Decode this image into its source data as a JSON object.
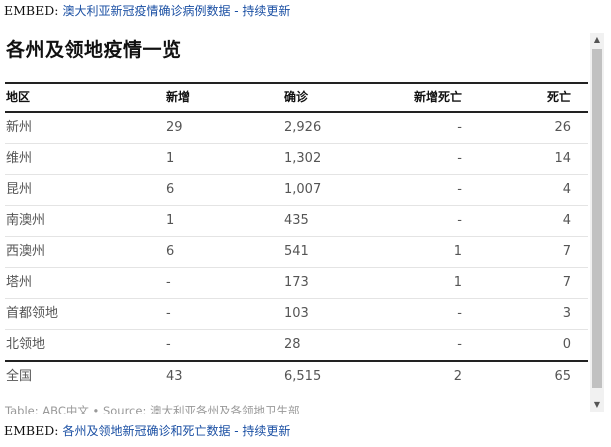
{
  "embed_top": {
    "prefix": "EMBED: ",
    "link": "澳大利亚新冠疫情确诊病例数据 - 持续更新"
  },
  "embed_bottom": {
    "prefix": "EMBED: ",
    "link": "各州及领地新冠确诊和死亡数据 - 持续更新"
  },
  "title": "各州及领地疫情一览",
  "columns": [
    "地区",
    "新增",
    "确诊",
    "新增死亡",
    "死亡"
  ],
  "rows": [
    [
      "新州",
      "29",
      "2,926",
      "-",
      "26"
    ],
    [
      "维州",
      "1",
      "1,302",
      "-",
      "14"
    ],
    [
      "昆州",
      "6",
      "1,007",
      "-",
      "4"
    ],
    [
      "南澳州",
      "1",
      "435",
      "-",
      "4"
    ],
    [
      "西澳州",
      "6",
      "541",
      "1",
      "7"
    ],
    [
      "塔州",
      "-",
      "173",
      "1",
      "7"
    ],
    [
      "首都领地",
      "-",
      "103",
      "-",
      "3"
    ],
    [
      "北领地",
      "-",
      "28",
      "-",
      "0"
    ]
  ],
  "total": [
    "全国",
    "43",
    "6,515",
    "2",
    "65"
  ],
  "source": "Table: ABC中文 • Source: 澳大利亚各州及各领地卫生部",
  "scrollbar": {
    "up_icon": "▲",
    "down_icon": "▼"
  }
}
